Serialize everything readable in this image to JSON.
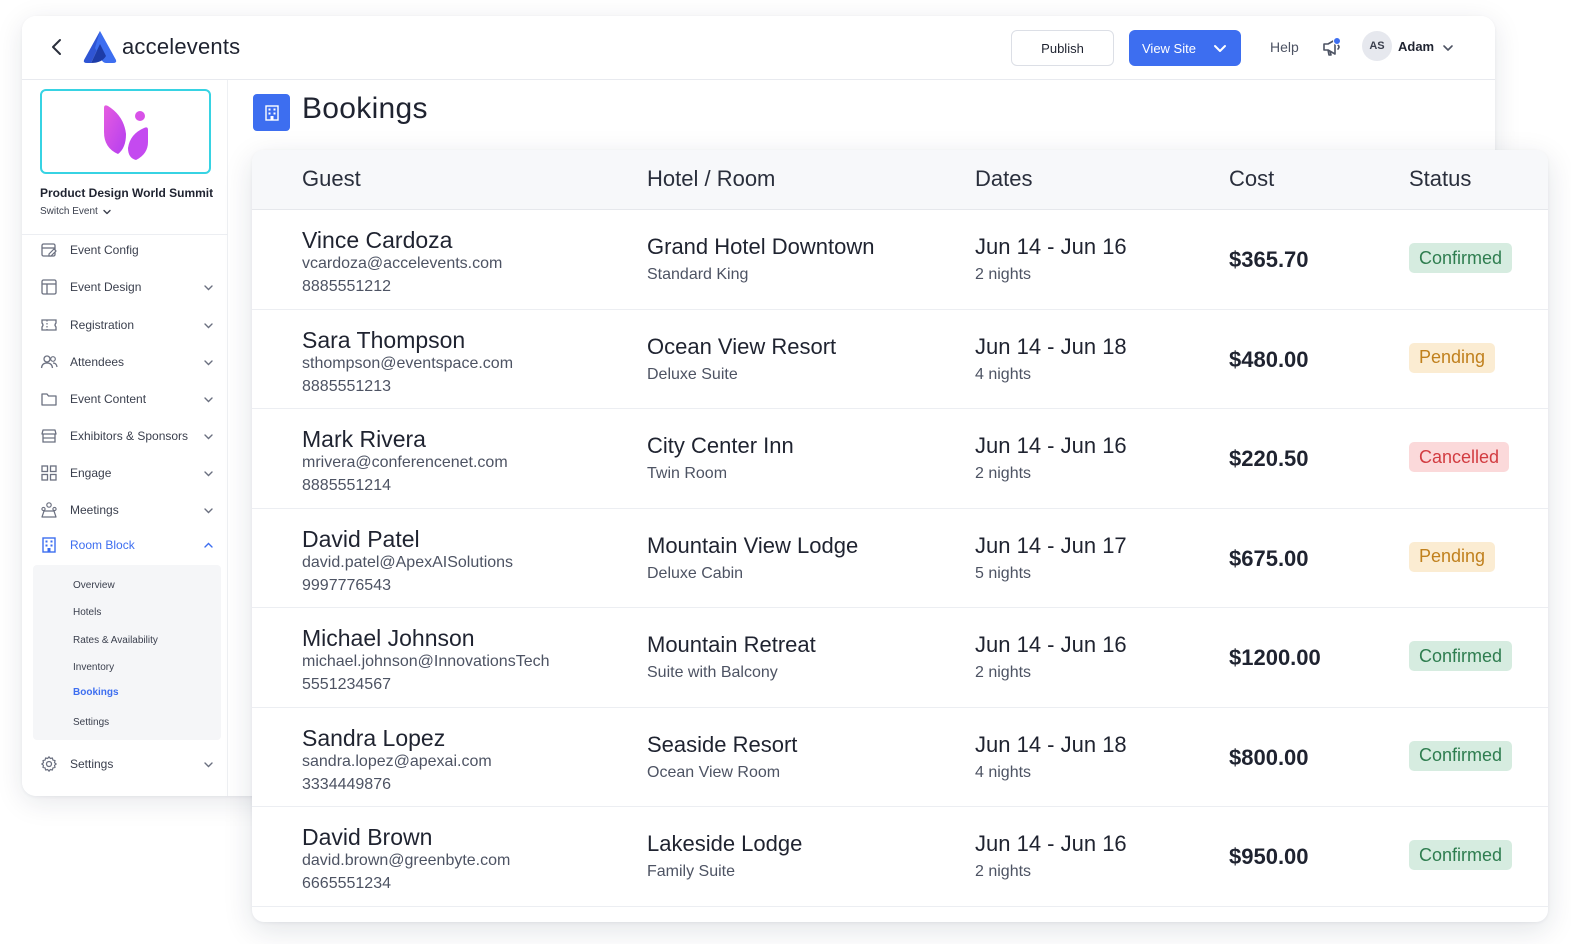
{
  "topbar": {
    "brand": "accelevents",
    "publish_label": "Publish",
    "viewsite_label": "View Site",
    "help_label": "Help",
    "user_initials": "AS",
    "user_name": "Adam"
  },
  "sidebar": {
    "event_name": "Product Design World Summit",
    "switch_event_label": "Switch Event",
    "items": [
      {
        "label": "Event Config",
        "icon": "calendar-edit-icon",
        "has_caret": false
      },
      {
        "label": "Event Design",
        "icon": "layout-icon",
        "has_caret": true
      },
      {
        "label": "Registration",
        "icon": "ticket-icon",
        "has_caret": true
      },
      {
        "label": "Attendees",
        "icon": "users-icon",
        "has_caret": true
      },
      {
        "label": "Event Content",
        "icon": "folder-icon",
        "has_caret": true
      },
      {
        "label": "Exhibitors & Sponsors",
        "icon": "booth-icon",
        "has_caret": true
      },
      {
        "label": "Engage",
        "icon": "grid-icon",
        "has_caret": true
      },
      {
        "label": "Meetings",
        "icon": "meeting-icon",
        "has_caret": true
      },
      {
        "label": "Room Block",
        "icon": "building-icon",
        "has_caret": true,
        "active": true
      },
      {
        "label": "Settings",
        "icon": "gear-icon",
        "has_caret": true
      }
    ],
    "room_block_submenu": [
      "Overview",
      "Hotels",
      "Rates & Availability",
      "Inventory",
      "Bookings",
      "Settings"
    ],
    "active_submenu": "Bookings"
  },
  "page": {
    "title": "Bookings"
  },
  "table": {
    "headers": [
      "Guest",
      "Hotel / Room",
      "Dates",
      "Cost",
      "Status"
    ],
    "rows": [
      {
        "name": "Vince Cardoza",
        "email": "vcardoza@accelevents.com",
        "phone": "8885551212",
        "hotel": "Grand Hotel Downtown",
        "room": "Standard King",
        "dates": "Jun 14 - Jun 16",
        "nights": "2 nights",
        "cost": "$365.70",
        "status": "Confirmed"
      },
      {
        "name": "Sara Thompson",
        "email": "sthompson@eventspace.com",
        "phone": "8885551213",
        "hotel": "Ocean View Resort",
        "room": "Deluxe Suite",
        "dates": "Jun 14 - Jun 18",
        "nights": "4 nights",
        "cost": "$480.00",
        "status": "Pending"
      },
      {
        "name": "Mark Rivera",
        "email": "mrivera@conferencenet.com",
        "phone": "8885551214",
        "hotel": "City Center Inn",
        "room": "Twin Room",
        "dates": "Jun 14 - Jun 16",
        "nights": "2 nights",
        "cost": "$220.50",
        "status": "Cancelled"
      },
      {
        "name": "David Patel",
        "email": "david.patel@ApexAISolutions",
        "phone": "9997776543",
        "hotel": "Mountain View Lodge",
        "room": "Deluxe Cabin",
        "dates": "Jun 14 - Jun 17",
        "nights": "5 nights",
        "cost": "$675.00",
        "status": "Pending"
      },
      {
        "name": "Michael Johnson",
        "email": "michael.johnson@InnovationsTech",
        "phone": "5551234567",
        "hotel": "Mountain Retreat",
        "room": "Suite with Balcony",
        "dates": "Jun 14 - Jun 16",
        "nights": "2 nights",
        "cost": "$1200.00",
        "status": "Confirmed"
      },
      {
        "name": "Sandra Lopez",
        "email": "sandra.lopez@apexai.com",
        "phone": "3334449876",
        "hotel": "Seaside Resort",
        "room": "Ocean View Room",
        "dates": "Jun 14 - Jun 18",
        "nights": "4 nights",
        "cost": "$800.00",
        "status": "Confirmed"
      },
      {
        "name": "David Brown",
        "email": "david.brown@greenbyte.com",
        "phone": "6665551234",
        "hotel": "Lakeside Lodge",
        "room": "Family Suite",
        "dates": "Jun 14 - Jun 16",
        "nights": "2 nights",
        "cost": "$950.00",
        "status": "Confirmed"
      }
    ]
  },
  "colors": {
    "accent": "#3d6ef0",
    "confirmed_bg": "#d6ece0",
    "confirmed_text": "#2e7d4f",
    "pending_bg": "#fbecd2",
    "pending_text": "#c0801d",
    "cancelled_bg": "#fbd9da",
    "cancelled_text": "#d23c41"
  }
}
